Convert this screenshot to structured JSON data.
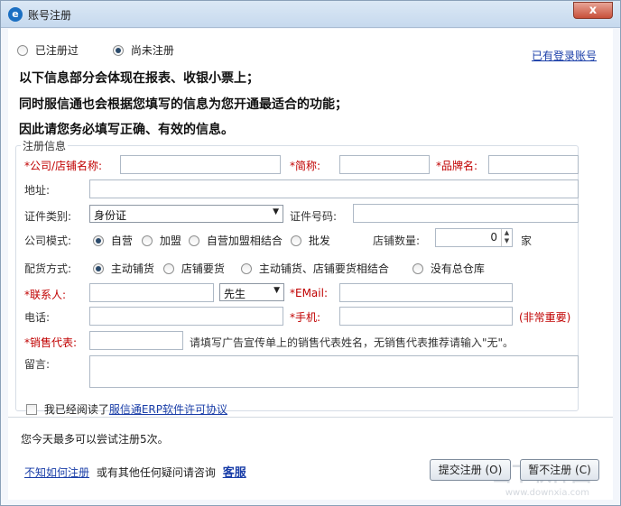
{
  "window": {
    "title": "账号注册",
    "close_label": "x"
  },
  "mode": {
    "registered_label": "已注册过",
    "unregistered_label": "尚未注册",
    "login_link": "已有登录账号"
  },
  "notice": {
    "line1": "以下信息部分会体现在报表、收银小票上；",
    "line2": "同时服信通也会根据您填写的信息为您开通最适合的功能；",
    "line3": "因此请您务必填写正确、有效的信息。"
  },
  "form": {
    "group_title": "注册信息",
    "company_label": "*公司/店铺名称:",
    "short_name_label": "*简称:",
    "brand_label": "*品牌名:",
    "address_label": "地址:",
    "id_type_label": "证件类别:",
    "id_type_value": "身份证",
    "id_number_label": "证件号码:",
    "company_mode_label": "公司模式:",
    "mode_options": [
      "自营",
      "加盟",
      "自营加盟相结合",
      "批发"
    ],
    "store_count_label": "店铺数量:",
    "store_count_value": "0",
    "store_unit": "家",
    "supply_label": "配货方式:",
    "supply_options": [
      "主动铺货",
      "店铺要货",
      "主动铺货、店铺要货相结合",
      "没有总仓库"
    ],
    "contact_label": "*联系人:",
    "title_value": "先生",
    "email_label": "*EMail:",
    "phone_label": "电话:",
    "mobile_label": "*手机:",
    "mobile_note": "(非常重要)",
    "sales_rep_label": "*销售代表:",
    "sales_rep_hint": "请填写广告宣传单上的销售代表姓名，无销售代表推荐请输入\"无\"。",
    "message_label": "留言:"
  },
  "agreement": {
    "prefix": "我已经阅读了",
    "link": "服信通ERP软件许可协议"
  },
  "attempts_text": "您今天最多可以尝试注册5次。",
  "footer": {
    "how_link": "不知如何注册",
    "middle_text": "或有其他任何疑问请咨询",
    "service_link": "客服",
    "submit_label": "提交注册 (O)",
    "cancel_label": "暂不注册 (C)"
  },
  "watermark": {
    "main": "当下软件园",
    "sub": "www.downxia.com"
  }
}
